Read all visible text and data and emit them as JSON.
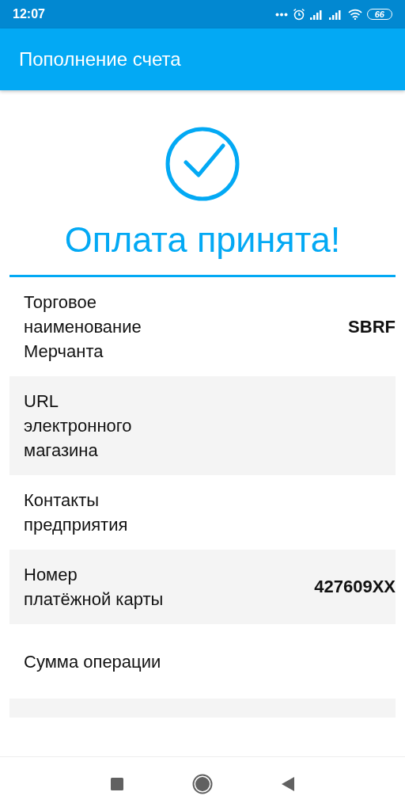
{
  "status_bar": {
    "time": "12:07",
    "battery": "66"
  },
  "app_bar": {
    "title": "Пополнение счета"
  },
  "result": {
    "title": "Оплата принята!"
  },
  "details": [
    {
      "label": "Торговое наименование Мерчанта",
      "value": "SBRF"
    },
    {
      "label": "URL электронного магазина"
    },
    {
      "label": "Контакты предприятия"
    },
    {
      "label": "Номер платёжной карты",
      "value": "427609XX"
    },
    {
      "label": "Сумма операции"
    }
  ]
}
